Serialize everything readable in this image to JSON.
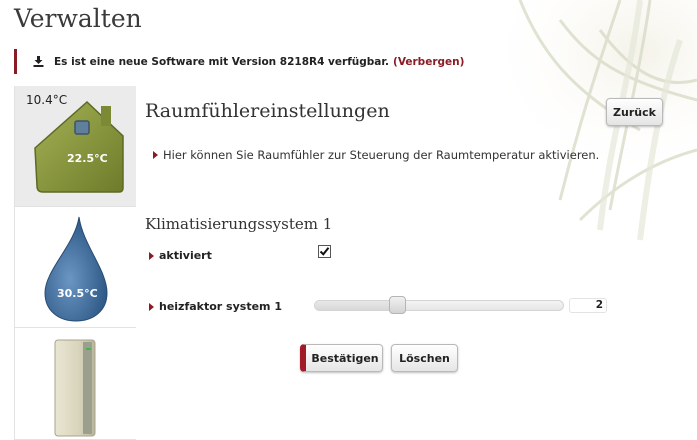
{
  "page": {
    "title": "Verwalten"
  },
  "notice": {
    "icon": "download-icon",
    "text": "Es ist eine neue Software mit Version 8218R4 verfügbar.",
    "hide_link": "(Verbergen)"
  },
  "sidebar": {
    "house": {
      "outside_temp": "10.4°C",
      "room_temp": "22.5°C",
      "icon": "house-icon"
    },
    "drop": {
      "temp": "30.5°C",
      "icon": "water-drop-icon"
    },
    "tank": {
      "icon": "water-heater-icon"
    }
  },
  "main": {
    "title": "Raumfühlereinstellungen",
    "back_label": "Zurück",
    "info": "Hier können Sie Raumfühler zur Steuerung der Raumtemperatur aktivieren.",
    "system_title": "Klimatisierungssystem 1",
    "activated_label": "aktiviert",
    "activated": true,
    "heizfaktor_label": "heizfaktor system 1",
    "heizfaktor_value": "2",
    "confirm_label": "Bestätigen",
    "clear_label": "Löschen"
  },
  "colors": {
    "accent": "#8a1a24",
    "house": "#8b9a3c",
    "drop": "#3f6d9e"
  }
}
